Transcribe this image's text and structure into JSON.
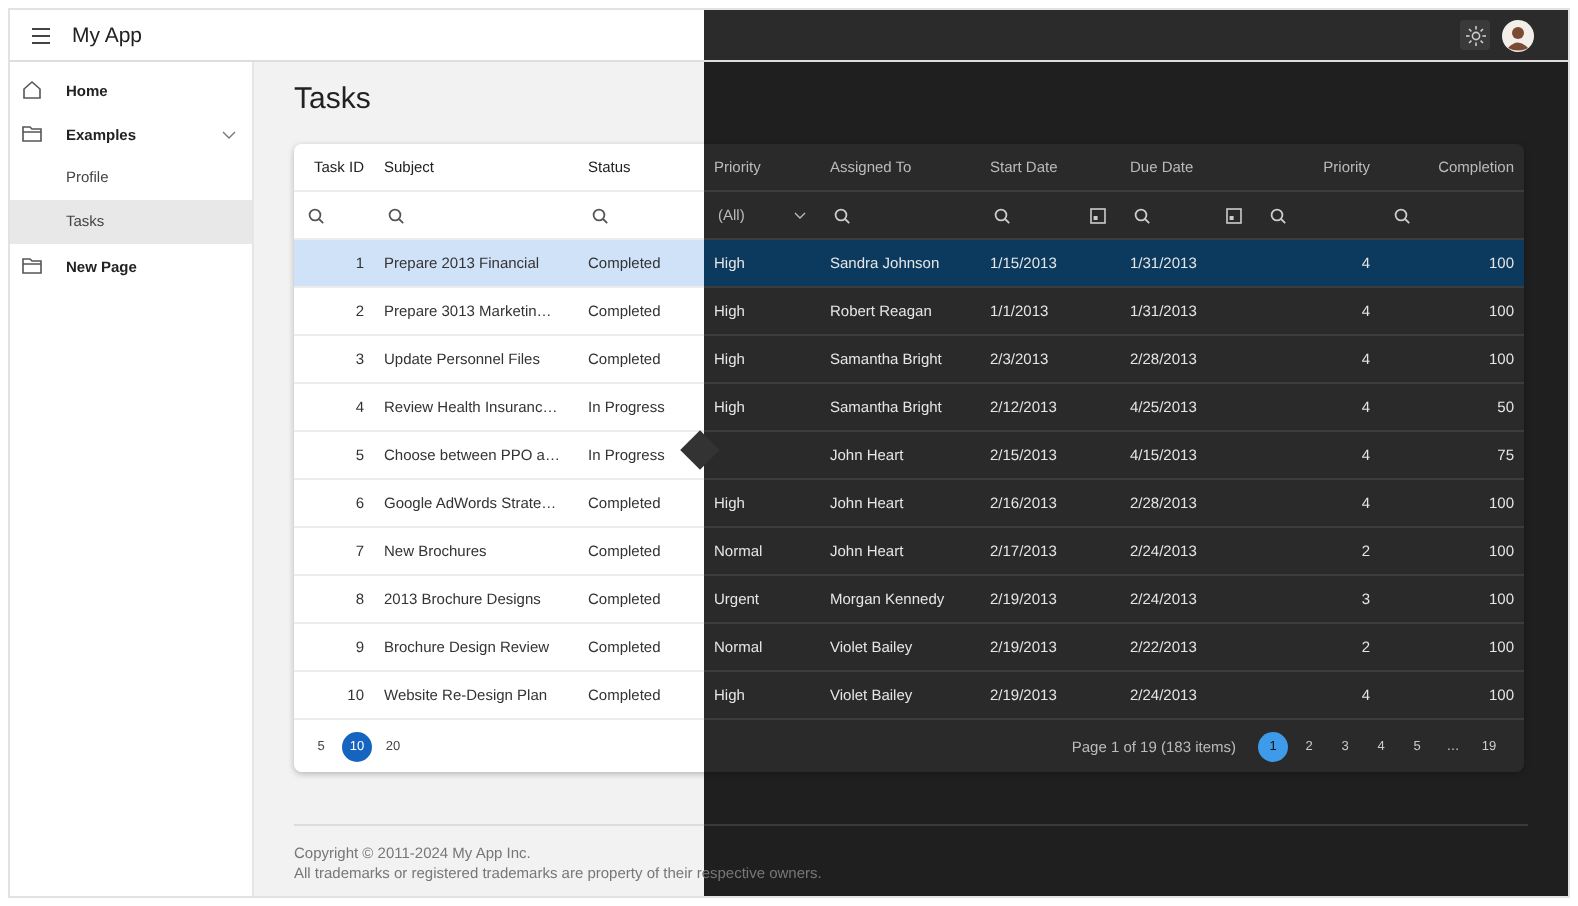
{
  "app": {
    "title": "My App"
  },
  "sidebar": {
    "items": [
      {
        "label": "Home",
        "selected": false
      },
      {
        "label": "Examples",
        "selected": false,
        "expanded": true,
        "children": [
          {
            "label": "Profile",
            "selected": false
          },
          {
            "label": "Tasks",
            "selected": true
          }
        ]
      },
      {
        "label": "New Page",
        "selected": false
      }
    ]
  },
  "page": {
    "title": "Tasks"
  },
  "grid": {
    "columns": [
      {
        "label": "Task ID",
        "numeric": true,
        "dark": false,
        "filter": {
          "kind": "search"
        }
      },
      {
        "label": "Subject",
        "numeric": false,
        "dark": false,
        "filter": {
          "kind": "search"
        }
      },
      {
        "label": "Status",
        "numeric": false,
        "dark": false,
        "filter": {
          "kind": "search"
        }
      },
      {
        "label": "Priority",
        "numeric": false,
        "dark": true,
        "filter": {
          "kind": "select",
          "value": "(All)"
        }
      },
      {
        "label": "Assigned To",
        "numeric": false,
        "dark": true,
        "filter": {
          "kind": "search"
        }
      },
      {
        "label": "Start Date",
        "numeric": false,
        "dark": true,
        "filter": {
          "kind": "date"
        }
      },
      {
        "label": "Due Date",
        "numeric": false,
        "dark": true,
        "filter": {
          "kind": "date"
        }
      },
      {
        "label": "Priority",
        "numeric": true,
        "dark": true,
        "filter": {
          "kind": "search"
        }
      },
      {
        "label": "Completion",
        "numeric": true,
        "dark": true,
        "filter": {
          "kind": "search"
        }
      }
    ],
    "rows": [
      {
        "selected": true,
        "cells": [
          "1",
          "Prepare 2013 Financial",
          "Completed",
          "High",
          "Sandra Johnson",
          "1/15/2013",
          "1/31/2013",
          "4",
          "100"
        ]
      },
      {
        "selected": false,
        "cells": [
          "2",
          "Prepare 3013 Marketin…",
          "Completed",
          "High",
          "Robert Reagan",
          "1/1/2013",
          "1/31/2013",
          "4",
          "100"
        ]
      },
      {
        "selected": false,
        "cells": [
          "3",
          "Update Personnel Files",
          "Completed",
          "High",
          "Samantha Bright",
          "2/3/2013",
          "2/28/2013",
          "4",
          "100"
        ]
      },
      {
        "selected": false,
        "cells": [
          "4",
          "Review Health Insuranc…",
          "In Progress",
          "High",
          "Samantha Bright",
          "2/12/2013",
          "4/25/2013",
          "4",
          "50"
        ]
      },
      {
        "selected": false,
        "cells": [
          "5",
          "Choose between PPO a…",
          "In Progress",
          null,
          "John Heart",
          "2/15/2013",
          "4/15/2013",
          "4",
          "75"
        ]
      },
      {
        "selected": false,
        "cells": [
          "6",
          "Google AdWords Strate…",
          "Completed",
          "High",
          "John Heart",
          "2/16/2013",
          "2/28/2013",
          "4",
          "100"
        ]
      },
      {
        "selected": false,
        "cells": [
          "7",
          "New Brochures",
          "Completed",
          "Normal",
          "John Heart",
          "2/17/2013",
          "2/24/2013",
          "2",
          "100"
        ]
      },
      {
        "selected": false,
        "cells": [
          "8",
          "2013 Brochure Designs",
          "Completed",
          "Urgent",
          "Morgan Kennedy",
          "2/19/2013",
          "2/24/2013",
          "3",
          "100"
        ]
      },
      {
        "selected": false,
        "cells": [
          "9",
          "Brochure Design Review",
          "Completed",
          "Normal",
          "Violet Bailey",
          "2/19/2013",
          "2/22/2013",
          "2",
          "100"
        ]
      },
      {
        "selected": false,
        "cells": [
          "10",
          "Website Re-Design Plan",
          "Completed",
          "High",
          "Violet Bailey",
          "2/19/2013",
          "2/24/2013",
          "4",
          "100"
        ]
      }
    ],
    "pager": {
      "page_sizes": [
        {
          "label": "5",
          "selected": false
        },
        {
          "label": "10",
          "selected": true
        },
        {
          "label": "20",
          "selected": false
        }
      ],
      "info": "Page 1 of 19 (183 items)",
      "pages": [
        {
          "label": "1",
          "selected": true
        },
        {
          "label": "2",
          "selected": false
        },
        {
          "label": "3",
          "selected": false
        },
        {
          "label": "4",
          "selected": false
        },
        {
          "label": "5",
          "selected": false
        },
        {
          "label": "…",
          "selected": false
        },
        {
          "label": "19",
          "selected": false
        }
      ]
    }
  },
  "footer": {
    "lines": [
      "Copyright © 2011-2024 My App Inc.",
      "All trademarks or registered trademarks are property of their respective owners."
    ]
  }
}
